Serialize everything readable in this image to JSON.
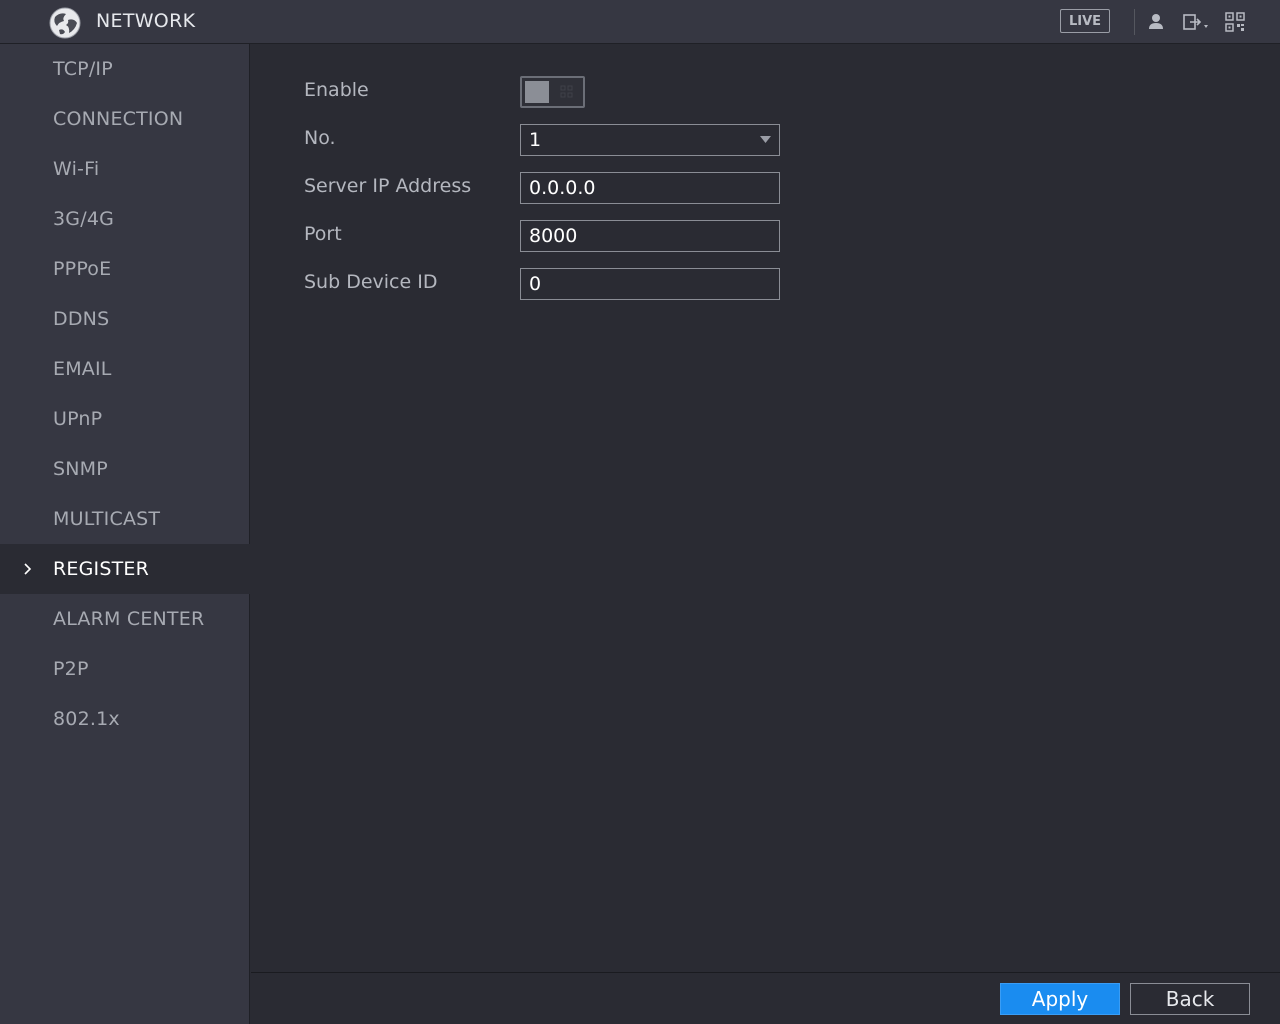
{
  "header": {
    "title": "NETWORK",
    "live_label": "LIVE",
    "icons": [
      "globe-logo-icon",
      "user-icon",
      "logout-icon",
      "qr-code-icon"
    ]
  },
  "sidebar": {
    "items": [
      {
        "label": "TCP/IP"
      },
      {
        "label": "CONNECTION"
      },
      {
        "label": "Wi-Fi"
      },
      {
        "label": "3G/4G"
      },
      {
        "label": "PPPoE"
      },
      {
        "label": "DDNS"
      },
      {
        "label": "EMAIL"
      },
      {
        "label": "UPnP"
      },
      {
        "label": "SNMP"
      },
      {
        "label": "MULTICAST"
      },
      {
        "label": "REGISTER"
      },
      {
        "label": "ALARM CENTER"
      },
      {
        "label": "P2P"
      },
      {
        "label": "802.1x"
      }
    ],
    "active": "REGISTER"
  },
  "form": {
    "enable": {
      "label": "Enable",
      "value": false
    },
    "number": {
      "label": "No.",
      "value": "1"
    },
    "server_ip": {
      "label": "Server IP Address",
      "value": "0.0.0.0"
    },
    "port": {
      "label": "Port",
      "value": "8000"
    },
    "sub_device_id": {
      "label": "Sub Device ID",
      "value": "0"
    }
  },
  "footer": {
    "apply_label": "Apply",
    "back_label": "Back"
  },
  "colors": {
    "accent": "#1a8cf0",
    "background": "#2a2b33",
    "sidebar": "#363742"
  }
}
